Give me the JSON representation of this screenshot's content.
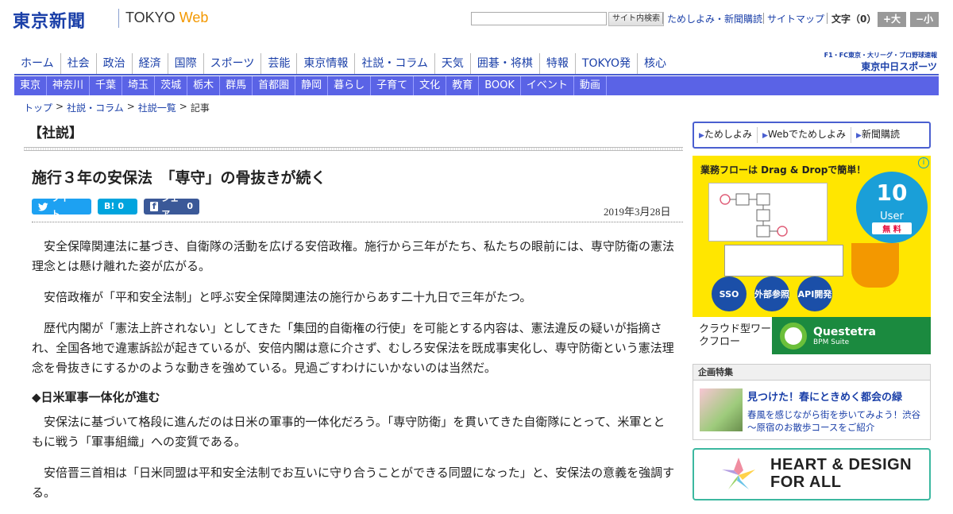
{
  "header": {
    "logo_jp": "東京新聞",
    "logo_en": "TOKYO",
    "logo_web": "Web",
    "search_button": "サイト内検索",
    "links": [
      "ためしよみ・新聞購読",
      "サイトマップ"
    ],
    "fontsize_label": "文字（0）",
    "font_plus": "+大",
    "font_minus": "−小"
  },
  "nav_main": [
    "ホーム",
    "社会",
    "政治",
    "経済",
    "国際",
    "スポーツ",
    "芸能",
    "東京情報",
    "社説・コラム",
    "天気",
    "囲碁・将棋",
    "特報",
    "TOKYO発",
    "核心"
  ],
  "sports_link": {
    "top": "F1・FC東京・大リーグ・プロ野球速報",
    "main": "東京中日スポーツ"
  },
  "nav_region": [
    "東京",
    "神奈川",
    "千葉",
    "埼玉",
    "茨城",
    "栃木",
    "群馬",
    "首都圏",
    "静岡",
    "暮らし",
    "子育て",
    "文化",
    "教育",
    "BOOK",
    "イベント",
    "動画"
  ],
  "breadcrumb": [
    "トップ",
    "社説・コラム",
    "社説一覧",
    "記事"
  ],
  "breadcrumb_sep": ">",
  "article": {
    "section": "【社説】",
    "headline": "施行３年の安保法　「専守」の骨抜きが続く",
    "share": {
      "tweet": "ツイート",
      "hatena_icon": "B!",
      "hatena_count": "0",
      "fb_label": "シェア",
      "fb_count": "0"
    },
    "date": "2019年3月28日",
    "paragraphs": [
      "安全保障関連法に基づき、自衛隊の活動を広げる安倍政権。施行から三年がたち、私たちの眼前には、専守防衛の憲法理念とは懸け離れた姿が広がる。",
      "安倍政権が「平和安全法制」と呼ぶ安全保障関連法の施行からあす二十九日で三年がたつ。",
      "歴代内閣が「憲法上許されない」としてきた「集団的自衛権の行使」を可能とする内容は、憲法違反の疑いが指摘され、全国各地で違憲訴訟が起きているが、安倍内閣は意に介さず、むしろ安保法を既成事実化し、専守防衛という憲法理念を骨抜きにするかのような動きを強めている。見過ごすわけにいかないのは当然だ。"
    ],
    "subheading": "◆日米軍事一体化が進む",
    "paragraphs2": [
      "安保法に基づいて格段に進んだのは日米の軍事的一体化だろう。「専守防衛」を貫いてきた自衛隊にとって、米軍とともに戦う「軍事組織」への変質である。",
      "安倍晋三首相は「日米同盟は平和安全法制でお互いに守り合うことができる同盟になった」と、安保法の意義を強調する。"
    ]
  },
  "sidebar": {
    "subscribe": [
      "ためしよみ",
      "Webでためしよみ",
      "新聞購読"
    ],
    "ad": {
      "head": "業務フローは Drag & Dropで簡単！",
      "num": "10",
      "user": "User",
      "free": "無 料",
      "circles": [
        "SSO",
        "外部参照",
        "API開発"
      ],
      "bottom_left": "クラウド型ワークフロー",
      "brand": "Questetra",
      "brand_sub": "BPM Suite"
    },
    "feature": {
      "header": "企画特集",
      "title": "見つけた！春にときめく都会の緑",
      "desc": "春風を感じながら街を歩いてみよう！渋谷～原宿のお散歩コースをご紹介"
    },
    "banner": {
      "line1": "HEART & DESIGN",
      "line2": "FOR ALL"
    }
  },
  "colors": {
    "brand_blue": "#1a3fa8",
    "nav_bar": "#5a63e6",
    "accent_orange": "#f39800",
    "ad_yellow": "#ffe600"
  }
}
